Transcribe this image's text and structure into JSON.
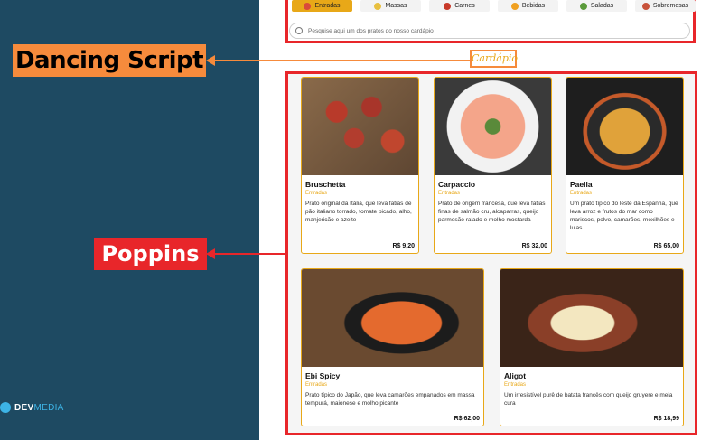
{
  "annotations": {
    "dancing_label": "Dancing Script",
    "poppins_label": "Poppins"
  },
  "brand": {
    "logo_bold": "DEV",
    "logo_light": "MEDIA"
  },
  "categories": [
    {
      "label": "Entradas",
      "icon": "bread-icon",
      "active": true
    },
    {
      "label": "Massas",
      "icon": "pasta-icon",
      "active": false
    },
    {
      "label": "Carnes",
      "icon": "meat-icon",
      "active": false
    },
    {
      "label": "Bebidas",
      "icon": "drink-icon",
      "active": false
    },
    {
      "label": "Saladas",
      "icon": "salad-icon",
      "active": false
    },
    {
      "label": "Sobremesas",
      "icon": "cake-icon",
      "active": false
    }
  ],
  "search": {
    "placeholder": "Pesquise aqui um dos pratos do nosso cardápio"
  },
  "section_title": "Cardápio",
  "dishes": [
    {
      "name": "Bruschetta",
      "category": "Entradas",
      "description": "Prato original da Itália, que leva fatias de pão italiano torrado, tomate picado, alho, manjericão e azeite",
      "price": "R$ 9,20"
    },
    {
      "name": "Carpaccio",
      "category": "Entradas",
      "description": "Prato de origem francesa, que leva fatias finas de salmão cru, alcaparras, queijo parmesão ralado e molho mostarda",
      "price": "R$ 32,00"
    },
    {
      "name": "Paella",
      "category": "Entradas",
      "description": "Um prato típico do leste da Espanha, que leva arroz e frutos do mar como mariscos, polvo, camarões, mexilhões e lulas",
      "price": "R$ 65,00"
    },
    {
      "name": "Ebi Spicy",
      "category": "Entradas",
      "description": "Prato típico do Japão, que leva camarões empanados em massa tempurá, maionese e molho picante",
      "price": "R$ 62,00"
    },
    {
      "name": "Aligot",
      "category": "Entradas",
      "description": "Um irresistível purê de batata francês com queijo gruyere e meia cura",
      "price": "R$ 18,99"
    }
  ],
  "colors": {
    "panel": "#1e4a62",
    "accent": "#e8a818",
    "highlight_red": "#e8262a",
    "highlight_orange": "#f68b3c"
  }
}
